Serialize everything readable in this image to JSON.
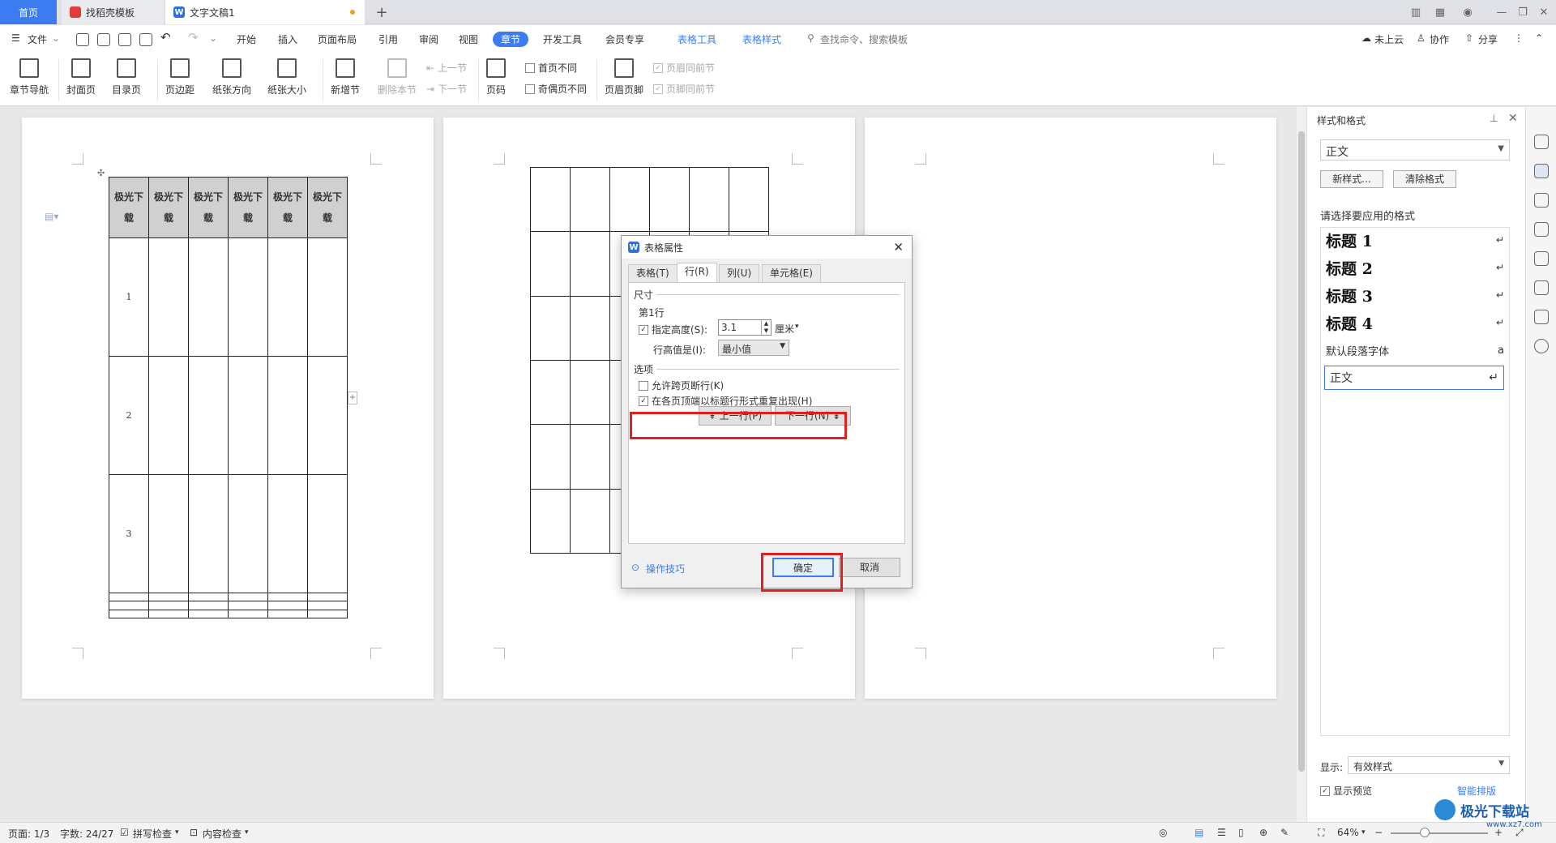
{
  "tabs": {
    "home": "首页",
    "t2": "找稻壳模板",
    "t3": "文字文稿1"
  },
  "menubar": {
    "file": "文件",
    "items": [
      "开始",
      "插入",
      "页面布局",
      "引用",
      "审阅",
      "视图",
      "章节",
      "开发工具",
      "会员专享"
    ],
    "context_tabs": [
      "表格工具",
      "表格样式"
    ],
    "search": "查找命令、搜索模板",
    "cloud": "未上云",
    "collab": "协作",
    "share": "分享"
  },
  "ribbon": {
    "nav": "章节导航",
    "cover": "封面页",
    "toc": "目录页",
    "margin": "页边距",
    "orient": "纸张方向",
    "size": "纸张大小",
    "newsec": "新增节",
    "delsec": "删除本节",
    "prev": "上一节",
    "next": "下一节",
    "pagenum": "页码",
    "firstdiff": "首页不同",
    "oddeven": "奇偶页不同",
    "headerfooter": "页眉页脚",
    "hsame": "页眉同前节",
    "fsame": "页脚同前节"
  },
  "doc": {
    "header_cell": "极光下\n载",
    "row_labels": [
      "1",
      "2",
      "3"
    ]
  },
  "dialog": {
    "title": "表格属性",
    "tabs": [
      "表格(T)",
      "行(R)",
      "列(U)",
      "单元格(E)"
    ],
    "size_section": "尺寸",
    "row_label": "第1行",
    "specify_height": "指定高度(S):",
    "height_value": "3.1",
    "unit": "厘米",
    "row_height_is": "行高值是(I):",
    "row_height_mode": "最小值",
    "options_section": "选项",
    "allow_break": "允许跨页断行(K)",
    "repeat_header": "在各页顶端以标题行形式重复出现(H)",
    "prev_row": "上一行(P)",
    "next_row": "下一行(N)",
    "tips": "操作技巧",
    "ok": "确定",
    "cancel": "取消"
  },
  "panel": {
    "title": "样式和格式",
    "current": "正文",
    "new_style": "新样式...",
    "clear": "清除格式",
    "choose_label": "请选择要应用的格式",
    "styles": [
      "标题 1",
      "标题 2",
      "标题 3",
      "标题 4"
    ],
    "default_font": "默认段落字体",
    "body": "正文",
    "show_label": "显示:",
    "show_value": "有效样式",
    "preview": "显示预览",
    "smart": "智能排版"
  },
  "status": {
    "page": "页面: 1/3",
    "words": "字数: 24/27",
    "spell": "拼写检查",
    "content": "内容检查",
    "zoom": "64%"
  },
  "watermark": "极光下载站",
  "watermark_url": "www.xz7.com"
}
